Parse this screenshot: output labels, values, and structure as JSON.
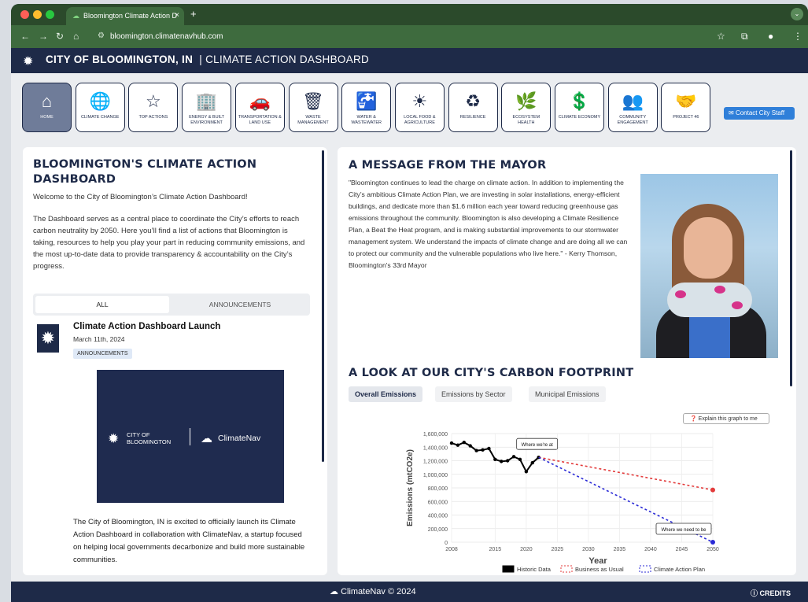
{
  "browser": {
    "tab_title": "Bloomington Climate Action D",
    "url": "bloomington.climatenavhub.com"
  },
  "site": {
    "title_bold": "CITY OF BLOOMINGTON, IN",
    "title_rest": "|  CLIMATE ACTION DASHBOARD"
  },
  "nav": {
    "items": [
      {
        "label": "HOME",
        "icon": "⌂"
      },
      {
        "label": "CLIMATE CHANGE",
        "icon": "🌐"
      },
      {
        "label": "TOP ACTIONS",
        "icon": "☆"
      },
      {
        "label": "ENERGY & BUILT ENVIRONMENT",
        "icon": "🏢"
      },
      {
        "label": "TRANSPORTATION & LAND USE",
        "icon": "🚗"
      },
      {
        "label": "WASTE MANAGEMENT",
        "icon": "🗑"
      },
      {
        "label": "WATER & WASTEWATER",
        "icon": "🚰"
      },
      {
        "label": "LOCAL FOOD & AGRICULTURE",
        "icon": "☀"
      },
      {
        "label": "RESILIENCE",
        "icon": "♻"
      },
      {
        "label": "ECOSYSTEM HEALTH",
        "icon": "🌿"
      },
      {
        "label": "CLIMATE ECONOMY",
        "icon": "💲"
      },
      {
        "label": "COMMUNITY ENGAGEMENT",
        "icon": "👥"
      },
      {
        "label": "PROJECT 46",
        "icon": "🤝"
      }
    ],
    "contact_label": "Contact City Staff"
  },
  "left": {
    "heading": "BLOOMINGTON'S CLIMATE ACTION DASHBOARD",
    "welcome": "Welcome to the City of Bloomington’s Climate Action Dashboard!",
    "intro": "The Dashboard serves as a central place to coordinate the City’s efforts to reach carbon neutrality by 2050. Here you’ll find a list of actions that Bloomington is taking, resources to help you play your part in reducing community emissions, and the most up-to-date data to provide transparency & accountability on the City’s progress.",
    "tab_all": "ALL",
    "tab_announcements": "ANNOUNCEMENTS",
    "news": {
      "title": "Climate Action Dashboard Launch",
      "date": "March 11th, 2024",
      "badge": "ANNOUNCEMENTS",
      "banner_city": "CITY OF\nBLOOMINGTON",
      "banner_brand": "ClimateNav",
      "body": "The City of Bloomington, IN is excited to officially launch its Climate Action Dashboard in collaboration with ClimateNav, a startup focused on helping local governments decarbonize and build more sustainable communities."
    }
  },
  "right": {
    "mayor_heading": "A MESSAGE FROM THE MAYOR",
    "mayor_quote": "\"Bloomington continues to lead the charge on climate action. In addition to implementing the City’s ambitious Climate Action Plan, we are investing in solar installations, energy-efficient buildings, and dedicate more than $1.6 million each year toward reducing greenhouse gas emissions throughout the community.  Bloomington is also developing a Climate Resilience Plan, a Beat the Heat program, and is making substantial improvements to our stormwater management system. We understand the impacts of climate change and are doing all we can to protect our community and the vulnerable populations who live here.\" - Kerry Thomson, Bloomington's 33rd Mayor",
    "footprint_heading": "A LOOK AT OUR CITY'S CARBON FOOTPRINT",
    "tabs": [
      "Overall Emissions",
      "Emissions by Sector",
      "Municipal Emissions"
    ],
    "explain_label": "Explain this graph to me"
  },
  "chart_data": {
    "type": "line",
    "xlabel": "Year",
    "ylabel": "Emissions (mtCO2e)",
    "xlim": [
      2008,
      2050
    ],
    "ylim": [
      0,
      1600000
    ],
    "x_ticks": [
      "2008",
      "2015",
      "2020",
      "2025",
      "2030",
      "2035",
      "2040",
      "2045",
      "2050"
    ],
    "y_ticks": [
      "0",
      "200,000",
      "400,000",
      "600,000",
      "800,000",
      "1,000,000",
      "1,200,000",
      "1,400,000",
      "1,600,000"
    ],
    "series": [
      {
        "name": "Historic Data",
        "color": "#000000",
        "x": [
          2008,
          2009,
          2010,
          2011,
          2012,
          2013,
          2014,
          2015,
          2016,
          2017,
          2018,
          2019,
          2020,
          2021,
          2022
        ],
        "y": [
          1460000,
          1430000,
          1470000,
          1420000,
          1350000,
          1360000,
          1380000,
          1220000,
          1190000,
          1200000,
          1260000,
          1220000,
          1040000,
          1170000,
          1250000
        ]
      },
      {
        "name": "Business as Usual",
        "color": "#e33b3b",
        "x": [
          2022,
          2050
        ],
        "y": [
          1250000,
          770000
        ]
      },
      {
        "name": "Climate Action Plan",
        "color": "#2a2ad6",
        "x": [
          2022,
          2050
        ],
        "y": [
          1250000,
          0
        ]
      }
    ],
    "annotations": [
      "Where we're at",
      "Where we need to be"
    ]
  },
  "footer": {
    "brand": "ClimateNav",
    "copyright": "© 2024",
    "credits": "CREDITS"
  }
}
